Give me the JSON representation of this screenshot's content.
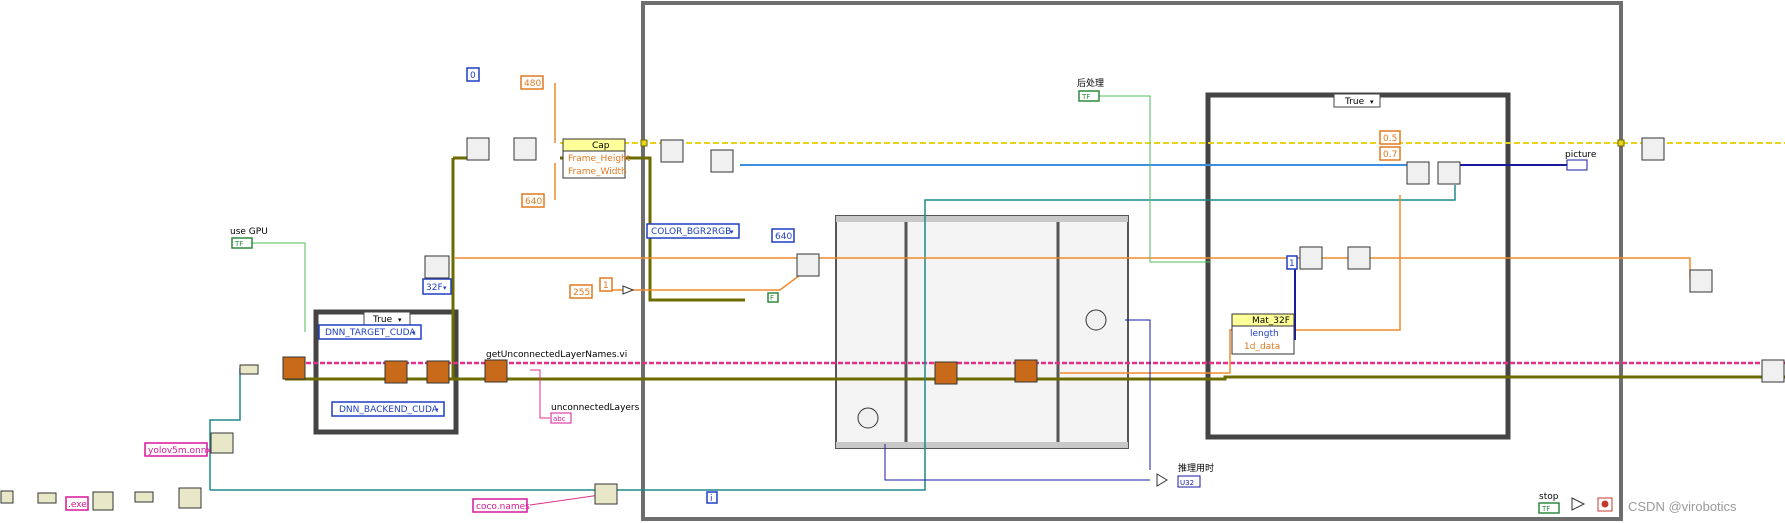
{
  "labels": {
    "use_gpu": "use GPU",
    "get_unconnected": "getUnconnectedLayerNames.vi",
    "unconnected_layers": "unconnectedLayers",
    "postprocess": "后处理",
    "picture": "picture",
    "inference_time": "推理用时",
    "stop": "stop",
    "watermark": "CSDN @virobotics"
  },
  "constants": {
    "zero": "0",
    "height_480": "480",
    "width_640": "640",
    "size_640": "640",
    "val_255": "255",
    "val_1": "1",
    "val_05": "0.5",
    "val_07": "0.7",
    "val_i": "1",
    "f_const": "F",
    "iter_i": "i",
    "dtype_32f": "32F",
    "color_bgr2rgb": "COLOR_BGR2RGB",
    "dnn_target_cuda": "DNN_TARGET_CUDA",
    "dnn_backend_cuda": "DNN_BACKEND_CUDA",
    "case_true_outer": "True",
    "case_true_inner": "True",
    "model_file": "yolov5m.onnx",
    "exe_ext": ".exe",
    "coco_names": "coco.names"
  },
  "property_nodes": {
    "cap": {
      "title": "Cap",
      "items": [
        "Frame_Height",
        "Frame_Width"
      ]
    },
    "mat": {
      "title": "Mat_32F",
      "items": [
        "length",
        "1d_data"
      ]
    }
  },
  "indicators": {
    "tf_bool": "TF",
    "picture_ind": "",
    "u32_ind": "U32",
    "abc_ind": "abc"
  },
  "colors": {
    "wire_yellow": "#e8d21a",
    "wire_olive": "#6b6b00",
    "wire_pink": "#e0308a",
    "wire_blue": "#3a8fe0",
    "wire_orange": "#f08a2a",
    "wire_teal": "#1e8a8a",
    "wire_green": "#4fbf5a",
    "wire_navy": "#1a1aa0",
    "wire_purple": "#7b3fa8",
    "frame_gray": "#6e6e6e"
  }
}
